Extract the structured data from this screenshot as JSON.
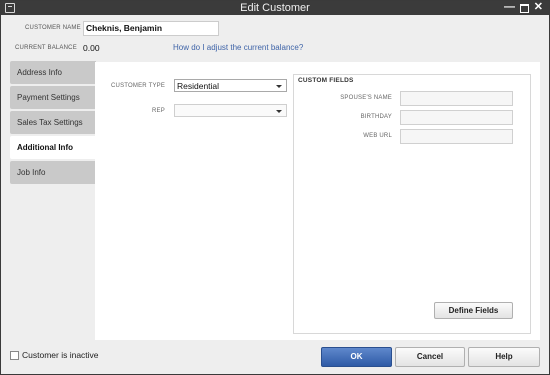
{
  "window": {
    "title": "Edit Customer",
    "minimize_glyph": "—",
    "close_glyph": "✕"
  },
  "header": {
    "customer_name_label": "CUSTOMER NAME",
    "customer_name_value": "Cheknis, Benjamin",
    "current_balance_label": "CURRENT BALANCE",
    "current_balance_value": "0.00",
    "adjust_balance_link": "How do I adjust the current balance?"
  },
  "tabs": [
    {
      "label": "Address Info",
      "active": false
    },
    {
      "label": "Payment Settings",
      "active": false
    },
    {
      "label": "Sales Tax Settings",
      "active": false
    },
    {
      "label": "Additional Info",
      "active": true
    },
    {
      "label": "Job Info",
      "active": false
    }
  ],
  "additional_info": {
    "customer_type_label": "CUSTOMER TYPE",
    "customer_type_value": "Residential",
    "rep_label": "REP",
    "rep_value": ""
  },
  "custom_fields": {
    "title": "CUSTOM FIELDS",
    "fields": [
      {
        "label": "SPOUSE'S NAME",
        "value": ""
      },
      {
        "label": "BIRTHDAY",
        "value": ""
      },
      {
        "label": "WEB URL",
        "value": ""
      }
    ],
    "define_fields_button": "Define Fields"
  },
  "footer": {
    "inactive_label": "Customer is inactive",
    "inactive_checked": false,
    "ok_button": "OK",
    "cancel_button": "Cancel",
    "help_button": "Help"
  },
  "colors": {
    "titlebar": "#3b3b3b",
    "link": "#3f64a8",
    "ok_button": "#3a68b5",
    "tab_inactive": "#c9c9c9"
  }
}
